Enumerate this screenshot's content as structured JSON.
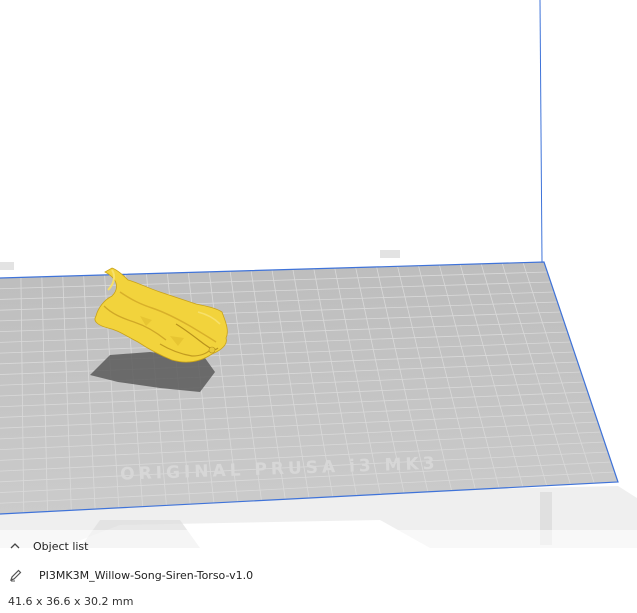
{
  "viewport": {
    "bed_brand_text": "ORIGINAL PRUSA i3 MK3",
    "model_color": "#f2d33c",
    "bed_color": "#c4c4c4",
    "grid_color": "#d6d6d6",
    "bounds_color": "#3f73d9"
  },
  "object_panel": {
    "header_label": "Object list",
    "header_icon": "chevron-up-icon",
    "edit_icon": "pencil-icon",
    "object_name": "PI3MK3M_Willow-Song-Siren-Torso-v1.0",
    "dimensions": "41.6 x 36.6 x 30.2 mm"
  }
}
